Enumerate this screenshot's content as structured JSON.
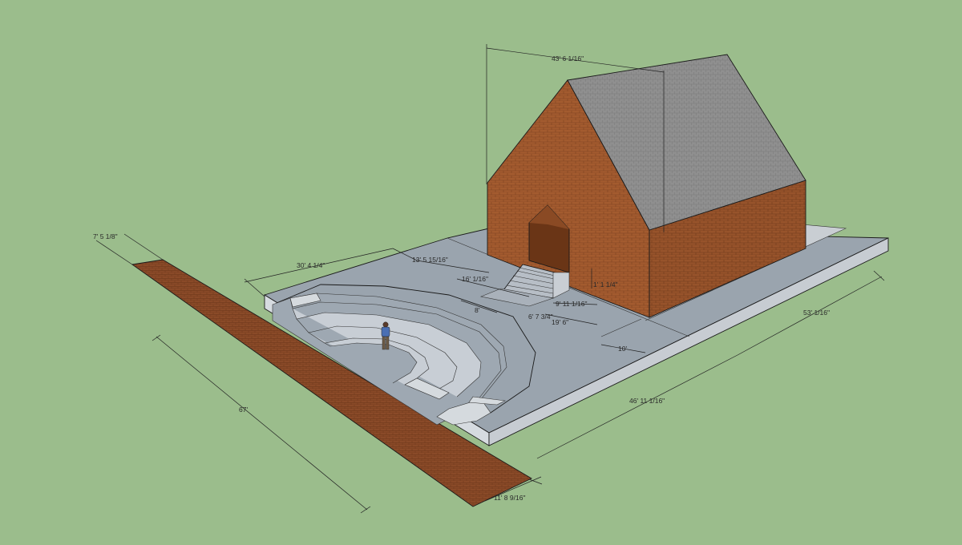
{
  "dimensions": {
    "width_7ft": "7' 5 1/8\"",
    "roof_43ft": "43' 6 1/16\"",
    "side_30ft": "30' 4 1/4\"",
    "inner_13ft": "13' 5 15/16\"",
    "inner_16ft": "16' 1/16\"",
    "stair_1ft": "1' 1 1/4\"",
    "inner_9ft": "9' 11 1/16\"",
    "inner_8ft": "8'",
    "inner_6ft": "6' 7 3/4\"",
    "inner_19ft": "19' 6\"",
    "inner_10ft": "10'",
    "long_67ft": "67'",
    "front_46ft": "46' 11 1/16\"",
    "side_53ft": "53' 1/16\"",
    "walk_11ft": "11' 8 9/16\""
  },
  "colors": {
    "background": "#9bbd8c",
    "brick": "#a05a30",
    "brick_dark": "#7a3f1e",
    "roof": "#8e8e8e",
    "plaza": "#9aa3ad",
    "plaza_side": "#d9dde2",
    "walkway": "#8a4a28"
  }
}
